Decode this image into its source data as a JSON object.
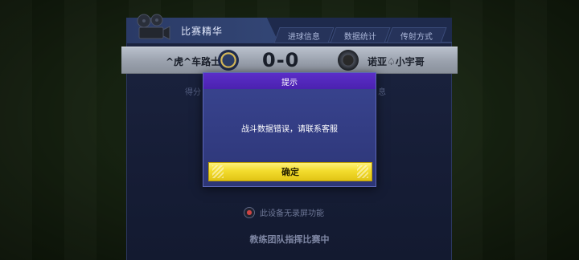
{
  "header": {
    "main_tab": "比赛精华",
    "sub_tabs": [
      "进球信息",
      "数据统计",
      "传射方式"
    ]
  },
  "match": {
    "home_team": "^虎^车路士",
    "away_team": "诺亚♤小宇哥",
    "score": "0-0"
  },
  "background_text": {
    "left_fragment": "得分",
    "right_fragment": "息",
    "recording": "此设备无录屏功能",
    "coach_status": "教练团队指挥比赛中"
  },
  "dialog": {
    "title": "提示",
    "message": "战斗数据错误，请联系客服",
    "confirm_label": "确定"
  },
  "colors": {
    "dialog_header": "#4b22b0",
    "dialog_body": "#343f86",
    "confirm_button": "#f3dc2e"
  },
  "icons": {
    "reel": "film-reel-icon",
    "home_badge": "team-badge-icon",
    "away_badge": "team-badge-icon",
    "recording": "no-record-icon"
  }
}
